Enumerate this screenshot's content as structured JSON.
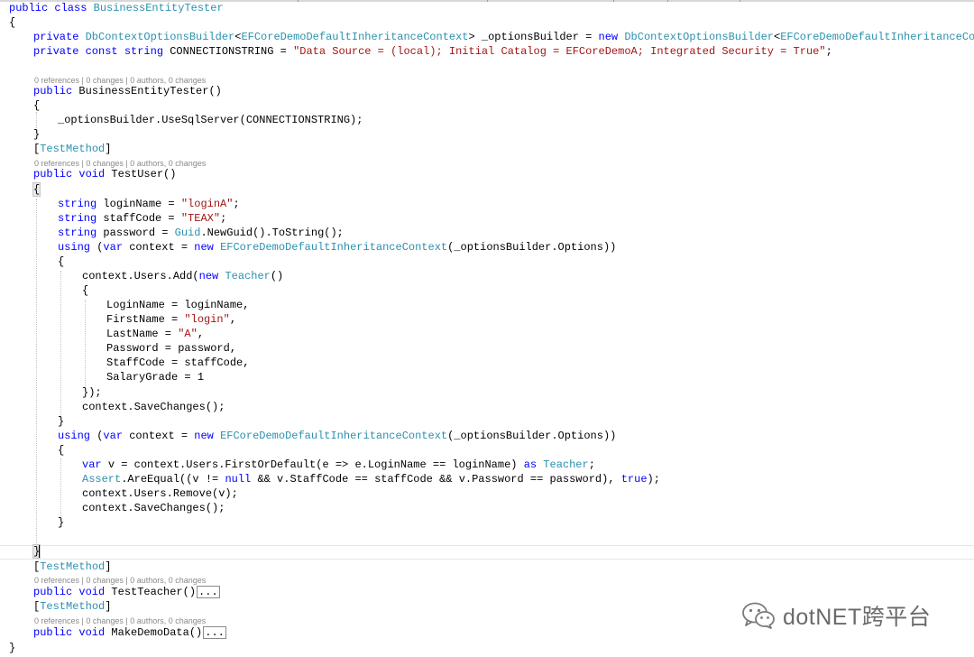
{
  "colors": {
    "keyword": "#0000ff",
    "type": "#2b91af",
    "string": "#a31515",
    "codelens": "#8a8a8a"
  },
  "codelens": {
    "refs_changes_authors": "0 references | 0 changes | 0 authors, 0 changes"
  },
  "code": {
    "l1_a": "public class ",
    "l1_b": "BusinessEntityTester",
    "l2": "{",
    "l3_a": "private ",
    "l3_b": "DbContextOptionsBuilder",
    "l3_c": "<",
    "l3_d": "EFCoreDemoDefaultInheritanceContext",
    "l3_e": "> _optionsBuilder = ",
    "l3_f": "new ",
    "l3_g": "DbContextOptionsBuilder",
    "l3_h": "<",
    "l3_i": "EFCoreDemoDefaultInheritanceContext",
    "l3_j": ">();",
    "l4_a": "private const string ",
    "l4_b": "CONNECTIONSTRING = ",
    "l4_c": "\"Data Source = (local); Initial Catalog = EFCoreDemoA; Integrated Security = True\"",
    "l4_d": ";",
    "l5_a": "public ",
    "l5_b": "BusinessEntityTester()",
    "l6": "{",
    "l7": "_optionsBuilder.UseSqlServer(CONNECTIONSTRING);",
    "l8": "}",
    "l9_a": "[",
    "l9_b": "TestMethod",
    "l9_c": "]",
    "l10_a": "public void ",
    "l10_b": "TestUser()",
    "l11": "{",
    "l12_a": "string ",
    "l12_b": "loginName = ",
    "l12_c": "\"loginA\"",
    "l12_d": ";",
    "l13_a": "string ",
    "l13_b": "staffCode = ",
    "l13_c": "\"TEAX\"",
    "l13_d": ";",
    "l14_a": "string ",
    "l14_b": "password = ",
    "l14_c": "Guid",
    "l14_d": ".NewGuid().ToString();",
    "l15_a": "using ",
    "l15_b": "(",
    "l15_c": "var ",
    "l15_d": "context = ",
    "l15_e": "new ",
    "l15_f": "EFCoreDemoDefaultInheritanceContext",
    "l15_g": "(_optionsBuilder.Options))",
    "l16": "{",
    "l17_a": "context.Users.Add(",
    "l17_b": "new ",
    "l17_c": "Teacher",
    "l17_d": "()",
    "l18": "{",
    "l19": "LoginName = loginName,",
    "l20_a": "FirstName = ",
    "l20_b": "\"login\"",
    "l20_c": ",",
    "l21_a": "LastName = ",
    "l21_b": "\"A\"",
    "l21_c": ",",
    "l22": "Password = password,",
    "l23": "StaffCode = staffCode,",
    "l24": "SalaryGrade = 1",
    "l25": "});",
    "l26": "context.SaveChanges();",
    "l27": "}",
    "l28_a": "using ",
    "l28_b": "(",
    "l28_c": "var ",
    "l28_d": "context = ",
    "l28_e": "new ",
    "l28_f": "EFCoreDemoDefaultInheritanceContext",
    "l28_g": "(_optionsBuilder.Options))",
    "l29": "{",
    "l30_a": "var ",
    "l30_b": "v = context.Users.FirstOrDefault(e => e.LoginName == loginName) ",
    "l30_c": "as ",
    "l30_d": "Teacher",
    "l30_e": ";",
    "l31_a": "Assert",
    "l31_b": ".AreEqual((v != ",
    "l31_c": "null ",
    "l31_d": "&& v.StaffCode == staffCode && v.Password == password), ",
    "l31_e": "true",
    "l31_f": ");",
    "l32": "context.Users.Remove(v);",
    "l33": "context.SaveChanges();",
    "l34": "}",
    "l35": "}",
    "l36_a": "[",
    "l36_b": "TestMethod",
    "l36_c": "]",
    "l37_a": "public void ",
    "l37_b": "TestTeacher()",
    "l38_a": "[",
    "l38_b": "TestMethod",
    "l38_c": "]",
    "l39_a": "public void ",
    "l39_b": "MakeDemoData()",
    "l40": "}",
    "collapsed": "..."
  },
  "watermark": {
    "text": "dotNET跨平台",
    "icon": "wechat-icon"
  }
}
